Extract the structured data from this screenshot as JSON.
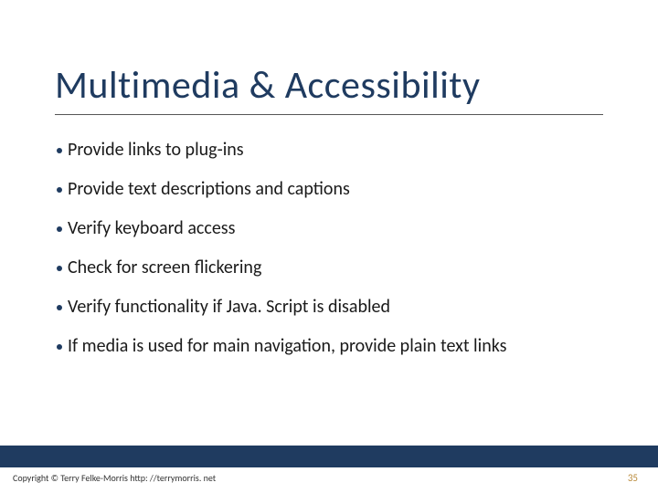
{
  "title": "Multimedia & Accessibility",
  "bullets": [
    "Provide links to plug-ins",
    "Provide text descriptions and captions",
    "Verify keyboard access",
    "Check for screen flickering",
    "Verify functionality if Java. Script is disabled",
    "If media is used for main navigation, provide plain text links"
  ],
  "footer": {
    "copyright": "Copyright © Terry Felke-Morris http: //terrymorris. net",
    "page": "35"
  }
}
